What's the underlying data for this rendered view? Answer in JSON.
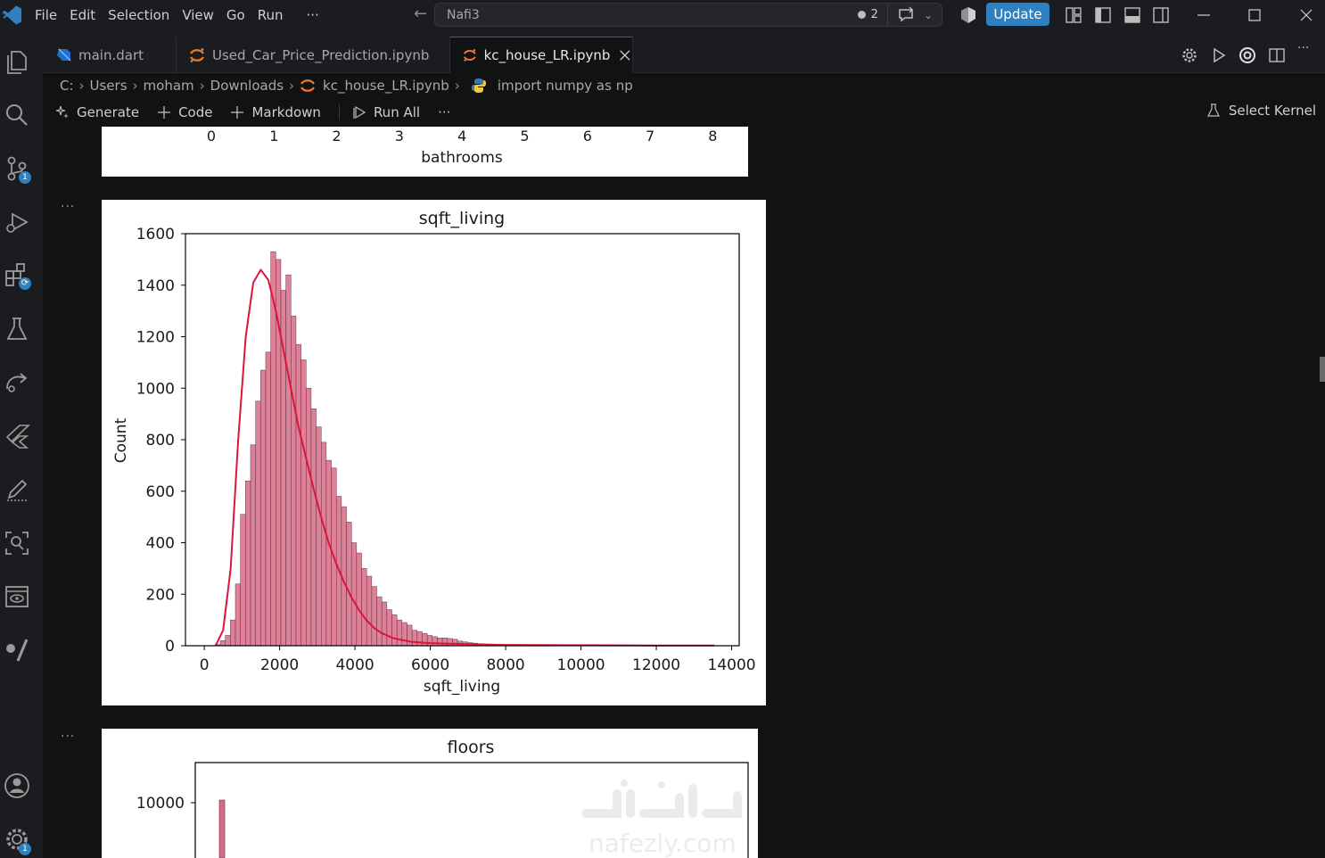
{
  "titlebar": {
    "menu": [
      "File",
      "Edit",
      "Selection",
      "View",
      "Go",
      "Run",
      "···"
    ],
    "search_text": "Nafi3",
    "badge_count": "2",
    "update_label": "Update"
  },
  "activity": {
    "source_control_badge": "1",
    "settings_badge": "1"
  },
  "tabs": [
    {
      "label": "main.dart",
      "icon": "dart-icon"
    },
    {
      "label": "Used_Car_Price_Prediction.ipynb",
      "icon": "jupyter-icon"
    },
    {
      "label": "kc_house_LR.ipynb",
      "icon": "jupyter-icon",
      "active": true
    }
  ],
  "breadcrumb": {
    "items": [
      "C:",
      "Users",
      "moham",
      "Downloads",
      "kc_house_LR.ipynb",
      "import numpy as np"
    ]
  },
  "notebook_toolbar": {
    "generate": "Generate",
    "code": "Code",
    "markdown": "Markdown",
    "run_all": "Run All",
    "more": "···",
    "select_kernel": "Select Kernel"
  },
  "cells": {
    "dots": "···"
  },
  "chart_data": [
    {
      "type": "bar",
      "note": "partially visible histogram (bottom only)",
      "xlabel": "bathrooms",
      "xticks": [
        "0",
        "1",
        "2",
        "3",
        "4",
        "5",
        "6",
        "7",
        "8"
      ]
    },
    {
      "type": "bar",
      "title": "sqft_living",
      "xlabel": "sqft_living",
      "ylabel": "Count",
      "xlim": [
        -500,
        14200
      ],
      "ylim": [
        0,
        1600
      ],
      "xticks": [
        "0",
        "2000",
        "4000",
        "6000",
        "8000",
        "10000",
        "12000",
        "14000"
      ],
      "yticks": [
        "0",
        "200",
        "400",
        "600",
        "800",
        "1000",
        "1200",
        "1400",
        "1600"
      ],
      "bar_color": "#d86a86",
      "kde_color": "#dc143c",
      "histogram": {
        "bin_width": 134,
        "start": 290,
        "counts": [
          5,
          20,
          40,
          100,
          240,
          510,
          640,
          780,
          950,
          1070,
          1140,
          1530,
          1500,
          1380,
          1440,
          1280,
          1170,
          1110,
          1000,
          920,
          850,
          790,
          720,
          690,
          580,
          540,
          480,
          400,
          360,
          300,
          270,
          230,
          190,
          170,
          140,
          120,
          100,
          90,
          80,
          60,
          55,
          48,
          40,
          35,
          30,
          30,
          28,
          25,
          18,
          15,
          12,
          10,
          8,
          6,
          6,
          5,
          4,
          4,
          3,
          3,
          3,
          2,
          2,
          2,
          2,
          2,
          1,
          1,
          1,
          1,
          1,
          1,
          1,
          1,
          1,
          1,
          1,
          1,
          1,
          1,
          1,
          1,
          1,
          1,
          1,
          1,
          1,
          1,
          1,
          1,
          1,
          1,
          1,
          1,
          1,
          1,
          1,
          1,
          1,
          1
        ]
      },
      "kde": {
        "x": [
          300,
          500,
          700,
          900,
          1100,
          1300,
          1500,
          1700,
          1900,
          2100,
          2300,
          2500,
          2700,
          2900,
          3100,
          3300,
          3500,
          3700,
          3900,
          4100,
          4300,
          4500,
          4700,
          5000,
          5500,
          6000,
          7000,
          8000,
          10000,
          12000,
          13540
        ],
        "y": [
          0,
          60,
          300,
          800,
          1200,
          1410,
          1460,
          1420,
          1300,
          1150,
          1000,
          850,
          730,
          610,
          500,
          400,
          320,
          250,
          190,
          140,
          100,
          70,
          50,
          30,
          15,
          10,
          6,
          3,
          2,
          1,
          1
        ]
      }
    },
    {
      "type": "bar",
      "note": "partially visible histogram (top only)",
      "title": "floors",
      "yticks": [
        "10000"
      ],
      "bar_color": "#d86a86",
      "visible_bar": {
        "x": 1.0,
        "y": 10400
      }
    }
  ]
}
